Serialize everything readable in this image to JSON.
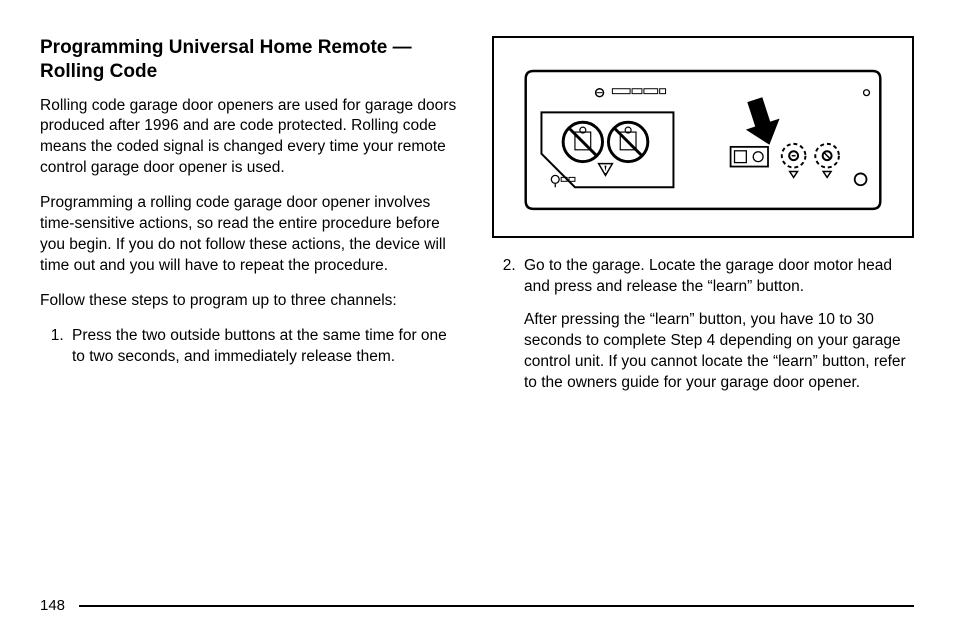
{
  "section": {
    "title": "Programming Universal Home Remote — Rolling Code",
    "para1": "Rolling code garage door openers are used for garage doors produced after 1996 and are code protected. Rolling code means the coded signal is changed every time your remote control garage door opener is used.",
    "para2": "Programming a rolling code garage door opener involves time-sensitive actions, so read the entire procedure before you begin. If you do not follow these actions, the device will time out and you will have to repeat the procedure.",
    "para3": "Follow these steps to program up to three channels:",
    "step1": "Press the two outside buttons at the same time for one to two seconds, and immediately release them.",
    "step2": "Go to the garage. Locate the garage door motor head and press and release the “learn” button.",
    "step2_extra": "After pressing the “learn” button, you have 10 to 30 seconds to complete Step 4 depending on your garage control unit. If you cannot locate the “learn” button, refer to the owners guide for your garage door opener."
  },
  "page_number": "148",
  "figure": {
    "alt": "Illustration of a garage door opener motor head unit with prohibition warning symbols on the left, a downward arrow pointing to a small Learn button panel in the center, two dashed-circle indicator icons, and a small round indicator on the right."
  }
}
